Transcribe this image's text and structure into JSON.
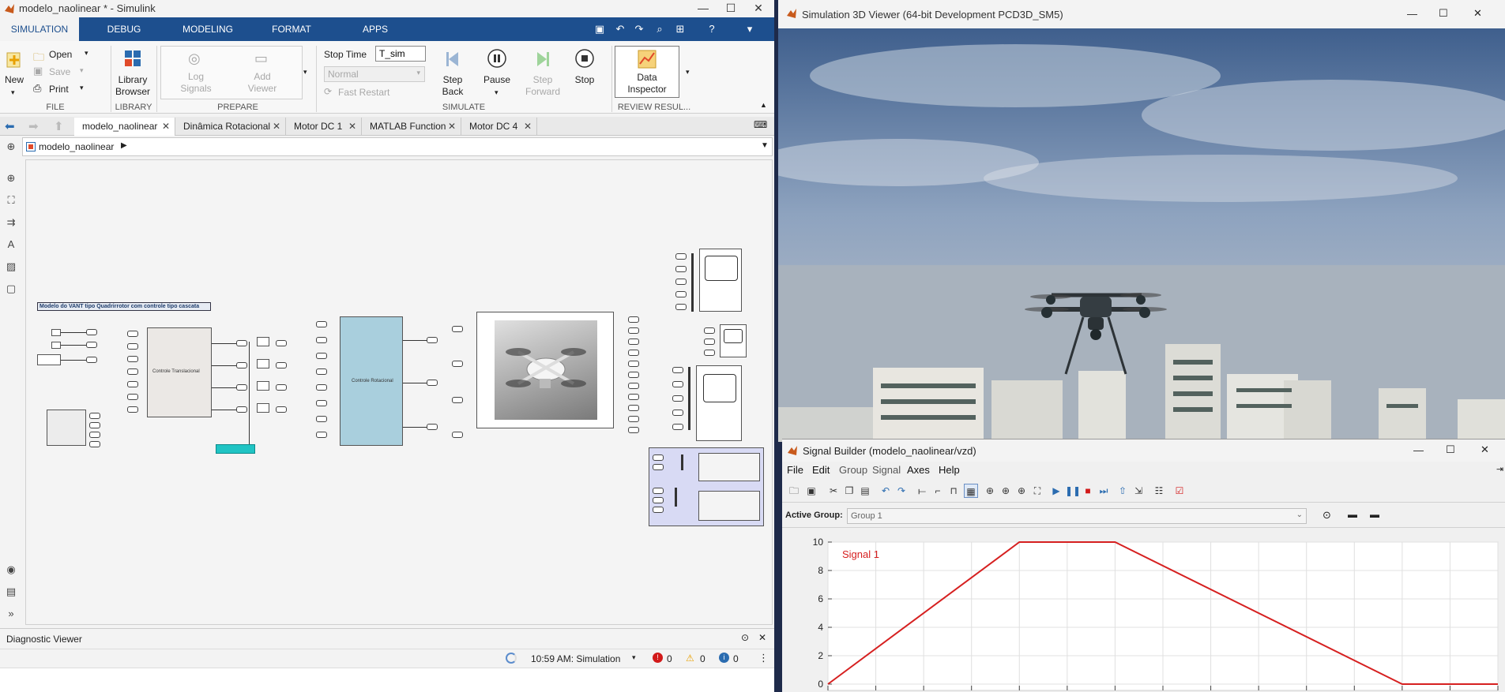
{
  "simulink": {
    "title": "modelo_naolinear * - Simulink",
    "tabs": [
      "SIMULATION",
      "DEBUG",
      "MODELING",
      "FORMAT",
      "APPS"
    ],
    "file_group": {
      "new": "New",
      "open": "Open",
      "save": "Save",
      "print": "Print",
      "label": "FILE"
    },
    "library_group": {
      "library_browser": "Library\nBrowser",
      "label": "LIBRARY"
    },
    "prepare_group": {
      "log_signals": "Log\nSignals",
      "add_viewer": "Add\nViewer",
      "label": "PREPARE"
    },
    "simulate_group": {
      "stop_time_label": "Stop Time",
      "stop_time_value": "T_sim",
      "mode": "Normal",
      "fast_restart": "Fast Restart",
      "step_back": "Step\nBack",
      "pause": "Pause",
      "step_forward": "Step\nForward",
      "stop": "Stop",
      "label": "SIMULATE"
    },
    "review_group": {
      "data_inspector": "Data\nInspector",
      "label": "REVIEW RESUL..."
    },
    "doc_tabs": [
      "modelo_naolinear",
      "Dinâmica Rotacional",
      "Motor DC 1",
      "MATLAB Function",
      "Motor DC 4"
    ],
    "breadcrumb": "modelo_naolinear",
    "model_annotation": "Modelo do VANT tipo Quadrirrotor com controle tipo cascata",
    "block_translational": "Controle Translacional",
    "block_rotational": "Controle Rotacional",
    "diagnostic_viewer": "Diagnostic Viewer",
    "status_time": "10:59 AM: Simulation",
    "errors": "0",
    "warnings": "0",
    "infos": "0"
  },
  "viewer": {
    "title": "Simulation 3D Viewer (64-bit Development PCD3D_SM5)"
  },
  "signal_builder": {
    "title": "Signal Builder (modelo_naolinear/vzd)",
    "menu": [
      "File",
      "Edit",
      "Group",
      "Signal",
      "Axes",
      "Help"
    ],
    "active_group_label": "Active Group:",
    "active_group_value": "Group 1",
    "signal_name": "Signal 1",
    "y_ticks": [
      "10",
      "8",
      "6",
      "4",
      "2",
      "0"
    ]
  },
  "chart_data": {
    "type": "line",
    "series": [
      {
        "name": "Signal 1",
        "x": [
          0,
          4,
          6,
          12,
          14
        ],
        "y": [
          0,
          10,
          10,
          0,
          0
        ]
      }
    ],
    "ylim": [
      0,
      10
    ],
    "xlim": [
      0,
      14
    ],
    "grid": true,
    "color": "#d62020"
  }
}
